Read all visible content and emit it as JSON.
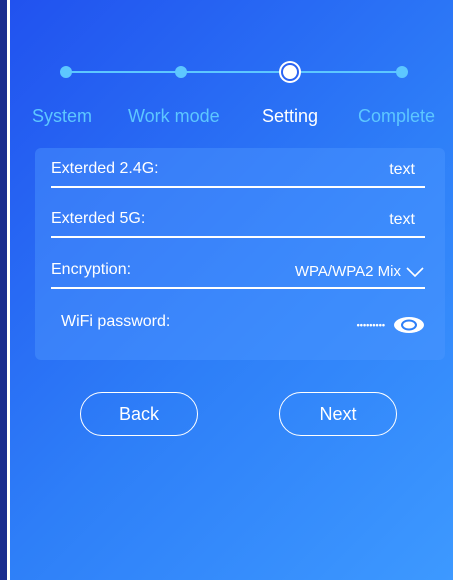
{
  "stepper": {
    "steps": [
      {
        "label": "System",
        "state": "done"
      },
      {
        "label": "Work mode",
        "state": "done"
      },
      {
        "label": "Setting",
        "state": "current"
      },
      {
        "label": "Complete",
        "state": "pending"
      }
    ]
  },
  "form": {
    "extended_24g": {
      "label": "Exterded 2.4G:",
      "value": "text"
    },
    "extended_5g": {
      "label": "Exterded 5G:",
      "value": "text"
    },
    "encryption": {
      "label": "Encryption:",
      "value": "WPA/WPA2 Mix"
    },
    "wifi_password": {
      "label": "WiFi password:",
      "value": "•••••••••"
    }
  },
  "buttons": {
    "back": "Back",
    "next": "Next"
  },
  "colors": {
    "accent": "#5dc7ff",
    "background_start": "#2152ef",
    "background_end": "#3d99ff"
  }
}
